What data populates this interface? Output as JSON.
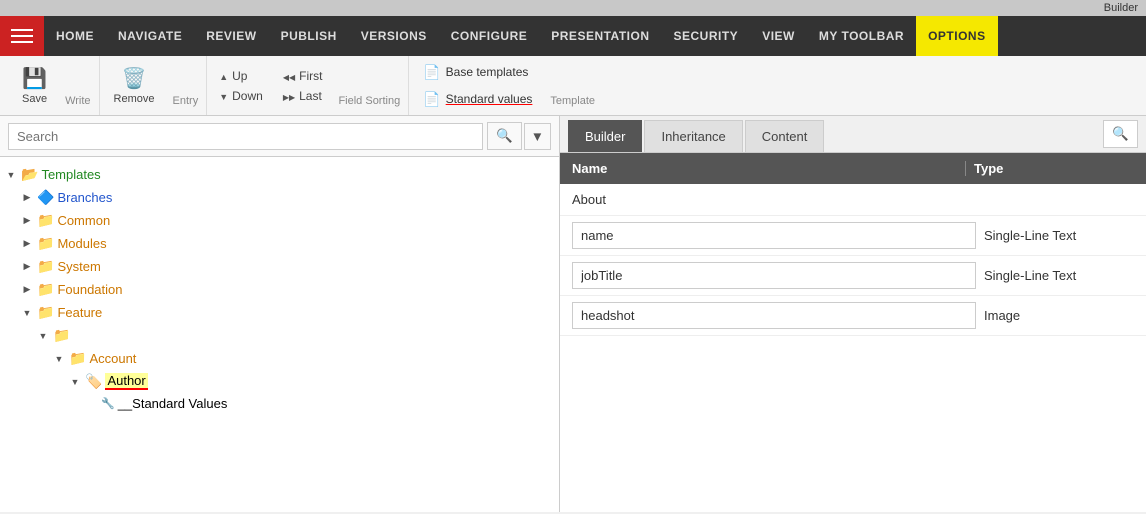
{
  "builderBar": {
    "label": "Builder"
  },
  "nav": {
    "hamburger": "☰",
    "items": [
      {
        "id": "home",
        "label": "HOME"
      },
      {
        "id": "navigate",
        "label": "NAVIGATE"
      },
      {
        "id": "review",
        "label": "REVIEW"
      },
      {
        "id": "publish",
        "label": "PUBLISH"
      },
      {
        "id": "versions",
        "label": "VERSIONS"
      },
      {
        "id": "configure",
        "label": "CONFIGURE"
      },
      {
        "id": "presentation",
        "label": "PRESENTATION"
      },
      {
        "id": "security",
        "label": "SECURITY"
      },
      {
        "id": "view",
        "label": "VIEW"
      },
      {
        "id": "my-toolbar",
        "label": "MY TOOLBAR"
      },
      {
        "id": "options",
        "label": "OPTIONS"
      }
    ]
  },
  "toolbar": {
    "write": {
      "save": "Save",
      "label": "Write"
    },
    "entry": {
      "remove": "Remove",
      "label": "Entry"
    },
    "fieldSorting": {
      "up": "Up",
      "down": "Down",
      "first": "First",
      "last": "Last",
      "label": "Field Sorting"
    },
    "template": {
      "baseTemplates": "Base templates",
      "standardValues": "Standard values",
      "label": "Template"
    }
  },
  "search": {
    "placeholder": "Search",
    "value": ""
  },
  "tree": {
    "items": [
      {
        "id": "templates",
        "label": "Templates",
        "level": 0,
        "expanded": true,
        "iconType": "folder-green",
        "color": "green"
      },
      {
        "id": "branches",
        "label": "Branches",
        "level": 1,
        "expanded": false,
        "iconType": "folder-blue",
        "color": "blue"
      },
      {
        "id": "common",
        "label": "Common",
        "level": 1,
        "expanded": false,
        "iconType": "folder-yellow",
        "color": "orange"
      },
      {
        "id": "modules",
        "label": "Modules",
        "level": 1,
        "expanded": false,
        "iconType": "folder-yellow",
        "color": "orange"
      },
      {
        "id": "system",
        "label": "System",
        "level": 1,
        "expanded": false,
        "iconType": "folder-yellow",
        "color": "orange"
      },
      {
        "id": "foundation",
        "label": "Foundation",
        "level": 1,
        "expanded": false,
        "iconType": "folder-yellow",
        "color": "orange"
      },
      {
        "id": "feature",
        "label": "Feature",
        "level": 1,
        "expanded": true,
        "iconType": "folder-yellow",
        "color": "orange"
      },
      {
        "id": "feature-folder",
        "label": "",
        "level": 2,
        "expanded": true,
        "iconType": "folder-plain",
        "color": "orange"
      },
      {
        "id": "account",
        "label": "Account",
        "level": 3,
        "expanded": true,
        "iconType": "folder-yellow",
        "color": "orange"
      },
      {
        "id": "author",
        "label": "Author",
        "level": 4,
        "expanded": true,
        "iconType": "template-icon",
        "color": "selected"
      },
      {
        "id": "standard-values",
        "label": "__Standard Values",
        "level": 5,
        "iconType": "template-small",
        "color": "dark"
      }
    ]
  },
  "rightPanel": {
    "tabs": [
      {
        "id": "builder",
        "label": "Builder",
        "active": true
      },
      {
        "id": "inheritance",
        "label": "Inheritance",
        "active": false
      },
      {
        "id": "content",
        "label": "Content",
        "active": false
      }
    ],
    "tableHeaders": {
      "name": "Name",
      "type": "Type"
    },
    "sectionHeader": "About",
    "rows": [
      {
        "id": "name-row",
        "fieldName": "name",
        "type": "Single-Line Text"
      },
      {
        "id": "jobtitle-row",
        "fieldName": "jobTitle",
        "type": "Single-Line Text"
      },
      {
        "id": "headshot-row",
        "fieldName": "headshot",
        "type": "Image"
      }
    ]
  }
}
